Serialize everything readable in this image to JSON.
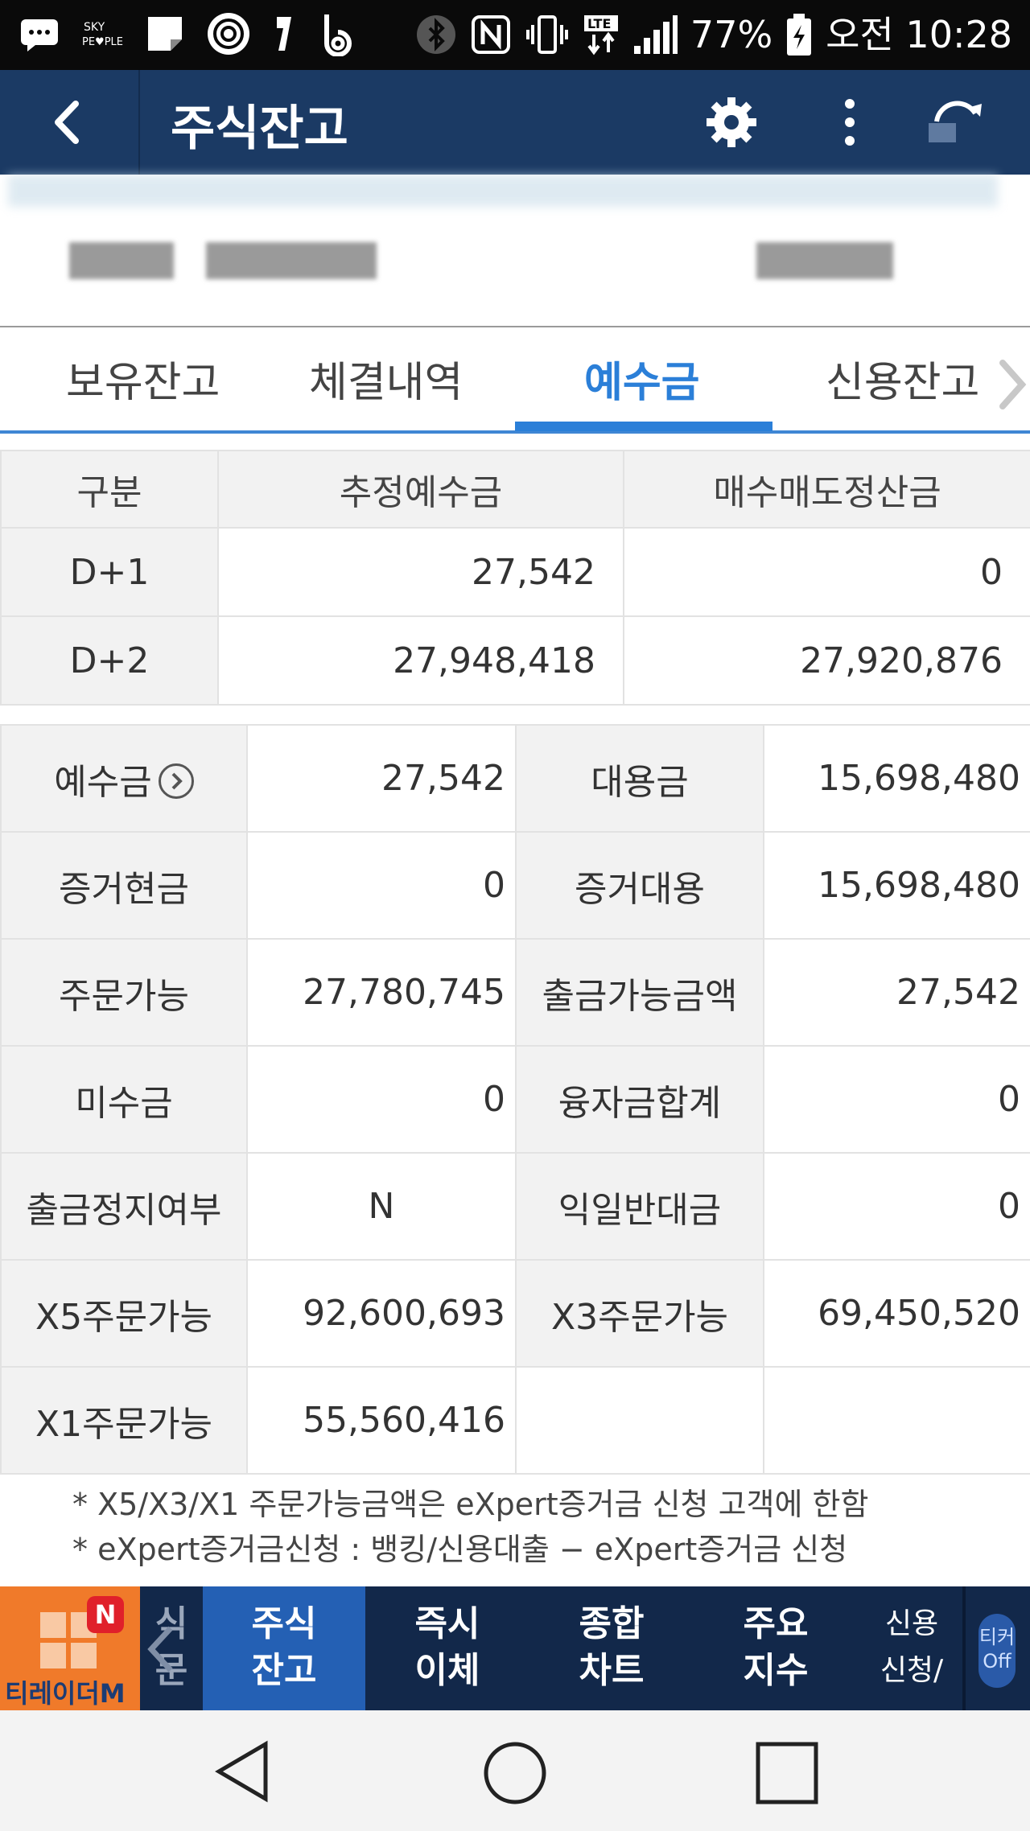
{
  "status_bar": {
    "battery": "77%",
    "time": "오전 10:28",
    "icons": [
      "message-icon",
      "sky-people-icon",
      "note-icon",
      "target-icon",
      "app-icon",
      "b-app-icon",
      "bluetooth-icon",
      "nfc-icon",
      "vibrate-icon",
      "lte-icon",
      "signal-icon",
      "battery-icon"
    ]
  },
  "app_bar": {
    "title": "주식잔고",
    "back_icon": "chevron-left-icon",
    "settings_icon": "gear-icon",
    "more_icon": "kebab-icon",
    "refresh_icon": "refresh-icon"
  },
  "tabs": [
    {
      "label": "보유잔고",
      "active": false
    },
    {
      "label": "체결내역",
      "active": false
    },
    {
      "label": "예수금",
      "active": true
    },
    {
      "label": "신용잔고",
      "active": false
    }
  ],
  "settlement_table": {
    "headers": [
      "구분",
      "추정예수금",
      "매수매도정산금"
    ],
    "rows": [
      {
        "label": "D+1",
        "estimated_deposit": "27,542",
        "settlement": "0"
      },
      {
        "label": "D+2",
        "estimated_deposit": "27,948,418",
        "settlement": "27,920,876"
      }
    ]
  },
  "detail_table": {
    "rows": [
      {
        "l1": "예수금",
        "v1": "27,542",
        "l2": "대용금",
        "v2": "15,698,480"
      },
      {
        "l1": "증거현금",
        "v1": "0",
        "l2": "증거대용",
        "v2": "15,698,480"
      },
      {
        "l1": "주문가능",
        "v1": "27,780,745",
        "l2": "출금가능금액",
        "v2": "27,542"
      },
      {
        "l1": "미수금",
        "v1": "0",
        "l2": "융자금합계",
        "v2": "0"
      },
      {
        "l1": "출금정지여부",
        "v1": "N",
        "l2": "익일반대금",
        "v2": "0"
      },
      {
        "l1": "X5주문가능",
        "v1": "92,600,693",
        "l2": "X3주문가능",
        "v2": "69,450,520"
      },
      {
        "l1": "X1주문가능",
        "v1": "55,560,416",
        "l2": "",
        "v2": ""
      }
    ]
  },
  "notes": [
    "* X5/X3/X1 주문가능금액은 eXpert증거금 신청 고객에 한함",
    "* eXpert증거금신청 : 뱅킹/신용대출 − eXpert증거금 신청"
  ],
  "bottom_menu": {
    "logo_text": "티레이더M",
    "logo_badge": "N",
    "partial_item": [
      "식",
      "문"
    ],
    "items": [
      {
        "line1": "주식",
        "line2": "잔고",
        "active": true
      },
      {
        "line1": "즉시",
        "line2": "이체",
        "active": false
      },
      {
        "line1": "종합",
        "line2": "차트",
        "active": false
      },
      {
        "line1": "주요",
        "line2": "지수",
        "active": false
      },
      {
        "line1": "신용",
        "line2": "신청/",
        "active": false
      }
    ],
    "ticker_toggle": {
      "line1": "티커",
      "line2": "Off"
    }
  },
  "colors": {
    "app_bar": "#1b3a64",
    "accent": "#2b7fd8",
    "bottom_menu": "#12284a",
    "bottom_menu_active": "#2460b4",
    "logo": "#f07a2a"
  }
}
